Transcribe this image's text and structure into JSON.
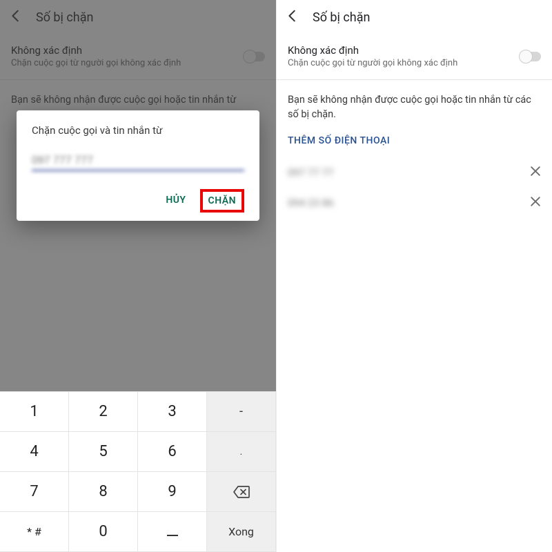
{
  "header": {
    "title": "Số bị chặn"
  },
  "setting": {
    "title": "Không xác định",
    "subtitle": "Chặn cuộc gọi từ người gọi không xác định"
  },
  "info_text": "Bạn sẽ không nhận được cuộc gọi hoặc tin nhắn từ các số bị chặn.",
  "info_text_cutoff_line1": "Bạn sẽ không nhận được cuộc gọi hoặc tin nhắn từ",
  "add_number_label": "THÊM SỐ ĐIỆN THOẠI",
  "blocked_numbers": [
    {
      "display": "097 77 77"
    },
    {
      "display": "094 23 86"
    }
  ],
  "dialog": {
    "title": "Chặn cuộc gọi và tin nhắn từ",
    "input_value": "097 777 777",
    "cancel": "HỦY",
    "confirm": "CHẶN"
  },
  "keypad": {
    "rows": [
      [
        "1",
        "2",
        "3",
        "-"
      ],
      [
        "4",
        "5",
        "6",
        "."
      ],
      [
        "7",
        "8",
        "9",
        "⌫"
      ],
      [
        "* #",
        "0",
        "_",
        "Xong"
      ]
    ],
    "done_label": "Xong"
  }
}
